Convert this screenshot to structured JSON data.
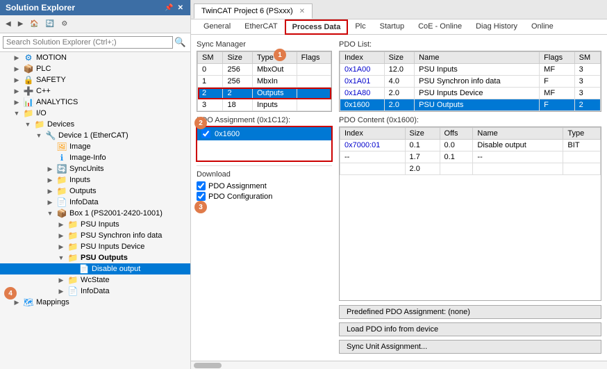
{
  "solutionExplorer": {
    "title": "Solution Explorer",
    "searchPlaceholder": "Search Solution Explorer (Ctrl+;)",
    "tree": [
      {
        "id": "motion",
        "label": "MOTION",
        "indent": 0,
        "icon": "⚙",
        "iconClass": "icon-gear",
        "expanded": true
      },
      {
        "id": "plc",
        "label": "PLC",
        "indent": 0,
        "icon": "📦",
        "iconClass": "icon-blue"
      },
      {
        "id": "safety",
        "label": "SAFETY",
        "indent": 0,
        "icon": "🔒",
        "iconClass": "icon-green"
      },
      {
        "id": "cpp",
        "label": "C++",
        "indent": 0,
        "icon": "➕",
        "iconClass": "icon-red"
      },
      {
        "id": "analytics",
        "label": "ANALYTICS",
        "indent": 0,
        "icon": "📊",
        "iconClass": "icon-teal"
      },
      {
        "id": "io",
        "label": "I/O",
        "indent": 0,
        "icon": "📁",
        "iconClass": "icon-folder",
        "expanded": true
      },
      {
        "id": "devices",
        "label": "Devices",
        "indent": 1,
        "icon": "📁",
        "iconClass": "icon-folder",
        "expanded": true
      },
      {
        "id": "device1",
        "label": "Device 1 (EtherCAT)",
        "indent": 2,
        "icon": "🔧",
        "iconClass": "icon-blue",
        "expanded": true
      },
      {
        "id": "image",
        "label": "Image",
        "indent": 3,
        "icon": "🖼",
        "iconClass": "icon-orange"
      },
      {
        "id": "imageinfo",
        "label": "Image-Info",
        "indent": 3,
        "icon": "ℹ",
        "iconClass": "icon-blue"
      },
      {
        "id": "syncunits",
        "label": "SyncUnits",
        "indent": 3,
        "icon": "🔄",
        "iconClass": "icon-teal",
        "hasToggle": true
      },
      {
        "id": "inputs",
        "label": "Inputs",
        "indent": 3,
        "icon": "📁",
        "iconClass": "icon-folder",
        "hasToggle": true
      },
      {
        "id": "outputs",
        "label": "Outputs",
        "indent": 3,
        "icon": "📁",
        "iconClass": "icon-folder",
        "hasToggle": true
      },
      {
        "id": "infodata",
        "label": "InfoData",
        "indent": 3,
        "icon": "📄",
        "iconClass": "icon-orange",
        "hasToggle": true
      },
      {
        "id": "box1",
        "label": "Box 1 (PS2001-2420-1001)",
        "indent": 3,
        "icon": "📦",
        "iconClass": "icon-blue",
        "expanded": true
      },
      {
        "id": "psuinputs",
        "label": "PSU Inputs",
        "indent": 4,
        "icon": "📁",
        "iconClass": "icon-folder",
        "hasToggle": true
      },
      {
        "id": "psusync",
        "label": "PSU Synchron info data",
        "indent": 4,
        "icon": "📁",
        "iconClass": "icon-folder",
        "hasToggle": true
      },
      {
        "id": "psuinputsdev",
        "label": "PSU Inputs Device",
        "indent": 4,
        "icon": "📁",
        "iconClass": "icon-folder",
        "hasToggle": true
      },
      {
        "id": "psuoutputs",
        "label": "PSU Outputs",
        "indent": 4,
        "icon": "📁",
        "iconClass": "icon-folder",
        "expanded": true
      },
      {
        "id": "disableoutput",
        "label": "Disable output",
        "indent": 5,
        "icon": "📄",
        "iconClass": "icon-red",
        "selected": false
      },
      {
        "id": "wcstate",
        "label": "WcState",
        "indent": 4,
        "icon": "📁",
        "iconClass": "icon-folder",
        "hasToggle": true
      },
      {
        "id": "infodata2",
        "label": "InfoData",
        "indent": 4,
        "icon": "📄",
        "iconClass": "icon-orange",
        "hasToggle": true
      }
    ]
  },
  "mainTab": {
    "title": "TwinCAT Project 6 (PSxxx)",
    "isPinned": false
  },
  "contentTabs": [
    {
      "id": "general",
      "label": "General"
    },
    {
      "id": "ethercat",
      "label": "EtherCAT"
    },
    {
      "id": "processdata",
      "label": "Process Data",
      "active": true
    },
    {
      "id": "plc",
      "label": "Plc"
    },
    {
      "id": "startup",
      "label": "Startup"
    },
    {
      "id": "coeonline",
      "label": "CoE - Online"
    },
    {
      "id": "diaghistory",
      "label": "Diag History"
    },
    {
      "id": "online",
      "label": "Online"
    }
  ],
  "syncManager": {
    "title": "Sync Manager",
    "columns": [
      "SM",
      "Size",
      "Type",
      "Flags"
    ],
    "rows": [
      {
        "sm": "0",
        "size": "256",
        "type": "MbxOut",
        "flags": "",
        "selected": false
      },
      {
        "sm": "1",
        "size": "256",
        "type": "MbxIn",
        "flags": "",
        "selected": false
      },
      {
        "sm": "2",
        "size": "2",
        "type": "Outputs",
        "flags": "",
        "selected": true
      },
      {
        "sm": "3",
        "size": "18",
        "type": "Inputs",
        "flags": "",
        "selected": false
      }
    ]
  },
  "pdoList": {
    "title": "PDO List:",
    "columns": [
      "Index",
      "Size",
      "Name",
      "Flags",
      "SM"
    ],
    "rows": [
      {
        "index": "0x1A00",
        "size": "12.0",
        "name": "PSU Inputs",
        "flags": "MF",
        "sm": "3"
      },
      {
        "index": "0x1A01",
        "size": "4.0",
        "name": "PSU Synchron info data",
        "flags": "F",
        "sm": "3"
      },
      {
        "index": "0x1A80",
        "size": "2.0",
        "name": "PSU Inputs Device",
        "flags": "MF",
        "sm": "3"
      },
      {
        "index": "0x1600",
        "size": "2.0",
        "name": "PSU Outputs",
        "flags": "F",
        "sm": "2",
        "selected": true
      }
    ]
  },
  "pdoAssignment": {
    "title": "PDO Assignment (0x1C12):",
    "items": [
      {
        "id": "0x1600",
        "label": "0x1600",
        "checked": true,
        "selected": true
      }
    ]
  },
  "pdoContent": {
    "title": "PDO Content (0x1600):",
    "columns": [
      "Index",
      "Size",
      "Offs",
      "Name",
      "Type"
    ],
    "rows": [
      {
        "index": "0x7000:01",
        "size": "0.1",
        "offs": "0.0",
        "name": "Disable output",
        "type": "BIT"
      },
      {
        "index": "--",
        "size": "1.7",
        "offs": "0.1",
        "name": "--",
        "type": ""
      },
      {
        "index": "",
        "size": "2.0",
        "offs": "",
        "name": "",
        "type": ""
      }
    ]
  },
  "download": {
    "title": "Download",
    "options": [
      {
        "id": "pdoAssignment",
        "label": "PDO Assignment",
        "checked": true
      },
      {
        "id": "pdoConfiguration",
        "label": "PDO Configuration",
        "checked": true
      }
    ]
  },
  "buttons": [
    {
      "id": "predefined",
      "label": "Predefined PDO Assignment: (none)"
    },
    {
      "id": "loadpdo",
      "label": "Load PDO info from device"
    },
    {
      "id": "syncunit",
      "label": "Sync Unit Assignment..."
    }
  ],
  "annotations": {
    "1": "1",
    "2": "2",
    "3": "3",
    "4": "4"
  }
}
